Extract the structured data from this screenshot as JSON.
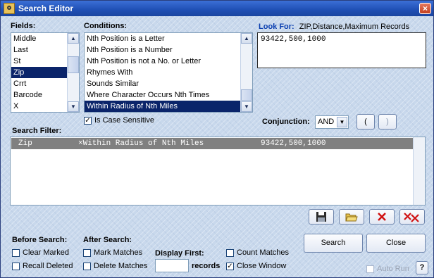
{
  "window": {
    "title": "Search Editor",
    "close_glyph": "×"
  },
  "fields": {
    "label": "Fields:",
    "items": [
      "Middle",
      "Last",
      "St",
      "Zip",
      "Crrt",
      "Barcode",
      "X"
    ],
    "selected_index": 3
  },
  "conditions": {
    "label": "Conditions:",
    "items": [
      "Nth Position is a Letter",
      "Nth Position is a Number",
      "Nth Position is not a No. or Letter",
      "Rhymes With",
      "Sounds Similar",
      "Where Character Occurs Nth Times",
      "Within Radius of Nth Miles"
    ],
    "selected_index": 6,
    "case_sensitive_label": "Is Case Sensitive",
    "case_sensitive_checked": true
  },
  "look_for": {
    "label": "Look For:",
    "hint": "ZIP,Distance,Maximum Records",
    "value": "93422,500,1000"
  },
  "conjunction": {
    "label": "Conjunction:",
    "value": "AND",
    "open_paren": "(",
    "close_paren": ")"
  },
  "search_filter": {
    "label": "Search Filter:",
    "rows": [
      {
        "field": "Zip",
        "condition": "×Within Radius of Nth Miles",
        "value": "93422,500,1000"
      }
    ]
  },
  "before_search": {
    "label": "Before Search:",
    "clear_marked": "Clear Marked",
    "recall_deleted": "Recall Deleted"
  },
  "after_search": {
    "label": "After Search:",
    "mark_matches": "Mark Matches",
    "delete_matches": "Delete Matches"
  },
  "display_first": {
    "label": "Display First:",
    "suffix": "records",
    "value": ""
  },
  "options": {
    "count_matches": "Count Matches",
    "close_window": "Close Window",
    "close_window_checked": true,
    "auto_run": "Auto Run",
    "help": "?"
  },
  "buttons": {
    "search": "Search",
    "close": "Close"
  },
  "icons": [
    "app-icon",
    "save-icon",
    "open-folder-icon",
    "delete-icon",
    "delete-all-icon"
  ]
}
